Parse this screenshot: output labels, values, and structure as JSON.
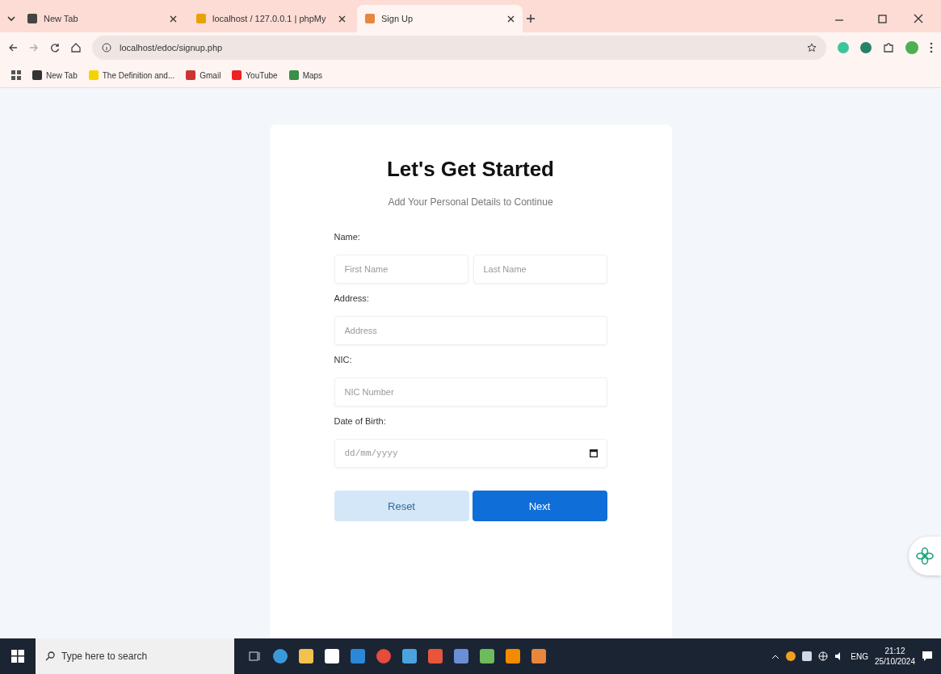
{
  "browser": {
    "tabs": [
      {
        "title": "New Tab",
        "selected": false
      },
      {
        "title": "localhost / 127.0.0.1 | phpMy",
        "selected": false
      },
      {
        "title": "Sign Up",
        "selected": true
      }
    ],
    "address": "localhost/edoc/signup.php",
    "bookmarks": [
      "New Tab",
      "The Definition and...",
      "Gmail",
      "YouTube",
      "Maps"
    ]
  },
  "form": {
    "title": "Let's Get Started",
    "subtitle": "Add Your Personal Details to Continue",
    "sections": [
      {
        "label": "Name:",
        "fields": [
          {
            "placeholder": "First Name"
          },
          {
            "placeholder": "Last Name"
          }
        ]
      },
      {
        "label": "Address:",
        "fields": [
          {
            "placeholder": "Address"
          }
        ]
      },
      {
        "label": "NIC:",
        "fields": [
          {
            "placeholder": "NIC Number"
          }
        ]
      },
      {
        "label": "Date of Birth:",
        "fields": [
          {
            "placeholder": "dd/mm/yyyy",
            "kind": "date"
          }
        ]
      }
    ],
    "buttons": [
      {
        "label": "Reset",
        "kind": "secondary"
      },
      {
        "label": "Next",
        "kind": "primary"
      }
    ]
  },
  "taskbar": {
    "search_placeholder": "Type here to search",
    "language": "ENG",
    "time": "21:12",
    "date": "25/10/2024"
  }
}
